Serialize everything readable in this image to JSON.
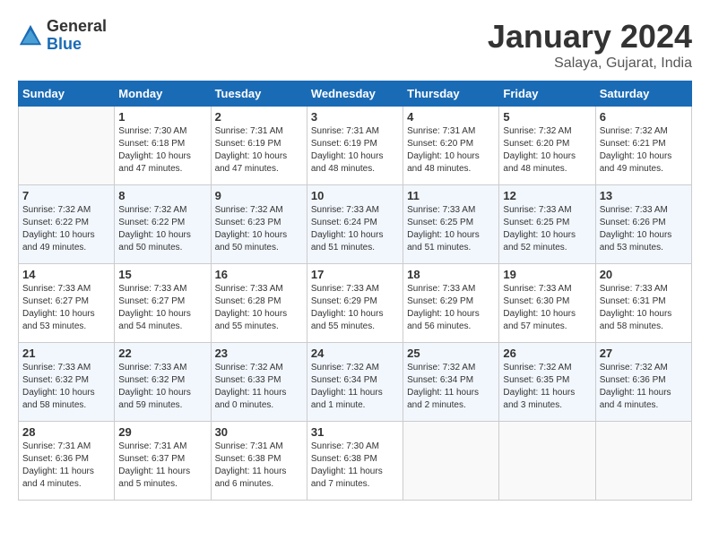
{
  "header": {
    "logo_general": "General",
    "logo_blue": "Blue",
    "month_title": "January 2024",
    "location": "Salaya, Gujarat, India"
  },
  "calendar": {
    "days_of_week": [
      "Sunday",
      "Monday",
      "Tuesday",
      "Wednesday",
      "Thursday",
      "Friday",
      "Saturday"
    ],
    "weeks": [
      [
        {
          "day": "",
          "info": ""
        },
        {
          "day": "1",
          "info": "Sunrise: 7:30 AM\nSunset: 6:18 PM\nDaylight: 10 hours\nand 47 minutes."
        },
        {
          "day": "2",
          "info": "Sunrise: 7:31 AM\nSunset: 6:19 PM\nDaylight: 10 hours\nand 47 minutes."
        },
        {
          "day": "3",
          "info": "Sunrise: 7:31 AM\nSunset: 6:19 PM\nDaylight: 10 hours\nand 48 minutes."
        },
        {
          "day": "4",
          "info": "Sunrise: 7:31 AM\nSunset: 6:20 PM\nDaylight: 10 hours\nand 48 minutes."
        },
        {
          "day": "5",
          "info": "Sunrise: 7:32 AM\nSunset: 6:20 PM\nDaylight: 10 hours\nand 48 minutes."
        },
        {
          "day": "6",
          "info": "Sunrise: 7:32 AM\nSunset: 6:21 PM\nDaylight: 10 hours\nand 49 minutes."
        }
      ],
      [
        {
          "day": "7",
          "info": "Sunrise: 7:32 AM\nSunset: 6:22 PM\nDaylight: 10 hours\nand 49 minutes."
        },
        {
          "day": "8",
          "info": "Sunrise: 7:32 AM\nSunset: 6:22 PM\nDaylight: 10 hours\nand 50 minutes."
        },
        {
          "day": "9",
          "info": "Sunrise: 7:32 AM\nSunset: 6:23 PM\nDaylight: 10 hours\nand 50 minutes."
        },
        {
          "day": "10",
          "info": "Sunrise: 7:33 AM\nSunset: 6:24 PM\nDaylight: 10 hours\nand 51 minutes."
        },
        {
          "day": "11",
          "info": "Sunrise: 7:33 AM\nSunset: 6:25 PM\nDaylight: 10 hours\nand 51 minutes."
        },
        {
          "day": "12",
          "info": "Sunrise: 7:33 AM\nSunset: 6:25 PM\nDaylight: 10 hours\nand 52 minutes."
        },
        {
          "day": "13",
          "info": "Sunrise: 7:33 AM\nSunset: 6:26 PM\nDaylight: 10 hours\nand 53 minutes."
        }
      ],
      [
        {
          "day": "14",
          "info": "Sunrise: 7:33 AM\nSunset: 6:27 PM\nDaylight: 10 hours\nand 53 minutes."
        },
        {
          "day": "15",
          "info": "Sunrise: 7:33 AM\nSunset: 6:27 PM\nDaylight: 10 hours\nand 54 minutes."
        },
        {
          "day": "16",
          "info": "Sunrise: 7:33 AM\nSunset: 6:28 PM\nDaylight: 10 hours\nand 55 minutes."
        },
        {
          "day": "17",
          "info": "Sunrise: 7:33 AM\nSunset: 6:29 PM\nDaylight: 10 hours\nand 55 minutes."
        },
        {
          "day": "18",
          "info": "Sunrise: 7:33 AM\nSunset: 6:29 PM\nDaylight: 10 hours\nand 56 minutes."
        },
        {
          "day": "19",
          "info": "Sunrise: 7:33 AM\nSunset: 6:30 PM\nDaylight: 10 hours\nand 57 minutes."
        },
        {
          "day": "20",
          "info": "Sunrise: 7:33 AM\nSunset: 6:31 PM\nDaylight: 10 hours\nand 58 minutes."
        }
      ],
      [
        {
          "day": "21",
          "info": "Sunrise: 7:33 AM\nSunset: 6:32 PM\nDaylight: 10 hours\nand 58 minutes."
        },
        {
          "day": "22",
          "info": "Sunrise: 7:33 AM\nSunset: 6:32 PM\nDaylight: 10 hours\nand 59 minutes."
        },
        {
          "day": "23",
          "info": "Sunrise: 7:32 AM\nSunset: 6:33 PM\nDaylight: 11 hours\nand 0 minutes."
        },
        {
          "day": "24",
          "info": "Sunrise: 7:32 AM\nSunset: 6:34 PM\nDaylight: 11 hours\nand 1 minute."
        },
        {
          "day": "25",
          "info": "Sunrise: 7:32 AM\nSunset: 6:34 PM\nDaylight: 11 hours\nand 2 minutes."
        },
        {
          "day": "26",
          "info": "Sunrise: 7:32 AM\nSunset: 6:35 PM\nDaylight: 11 hours\nand 3 minutes."
        },
        {
          "day": "27",
          "info": "Sunrise: 7:32 AM\nSunset: 6:36 PM\nDaylight: 11 hours\nand 4 minutes."
        }
      ],
      [
        {
          "day": "28",
          "info": "Sunrise: 7:31 AM\nSunset: 6:36 PM\nDaylight: 11 hours\nand 4 minutes."
        },
        {
          "day": "29",
          "info": "Sunrise: 7:31 AM\nSunset: 6:37 PM\nDaylight: 11 hours\nand 5 minutes."
        },
        {
          "day": "30",
          "info": "Sunrise: 7:31 AM\nSunset: 6:38 PM\nDaylight: 11 hours\nand 6 minutes."
        },
        {
          "day": "31",
          "info": "Sunrise: 7:30 AM\nSunset: 6:38 PM\nDaylight: 11 hours\nand 7 minutes."
        },
        {
          "day": "",
          "info": ""
        },
        {
          "day": "",
          "info": ""
        },
        {
          "day": "",
          "info": ""
        }
      ]
    ]
  }
}
